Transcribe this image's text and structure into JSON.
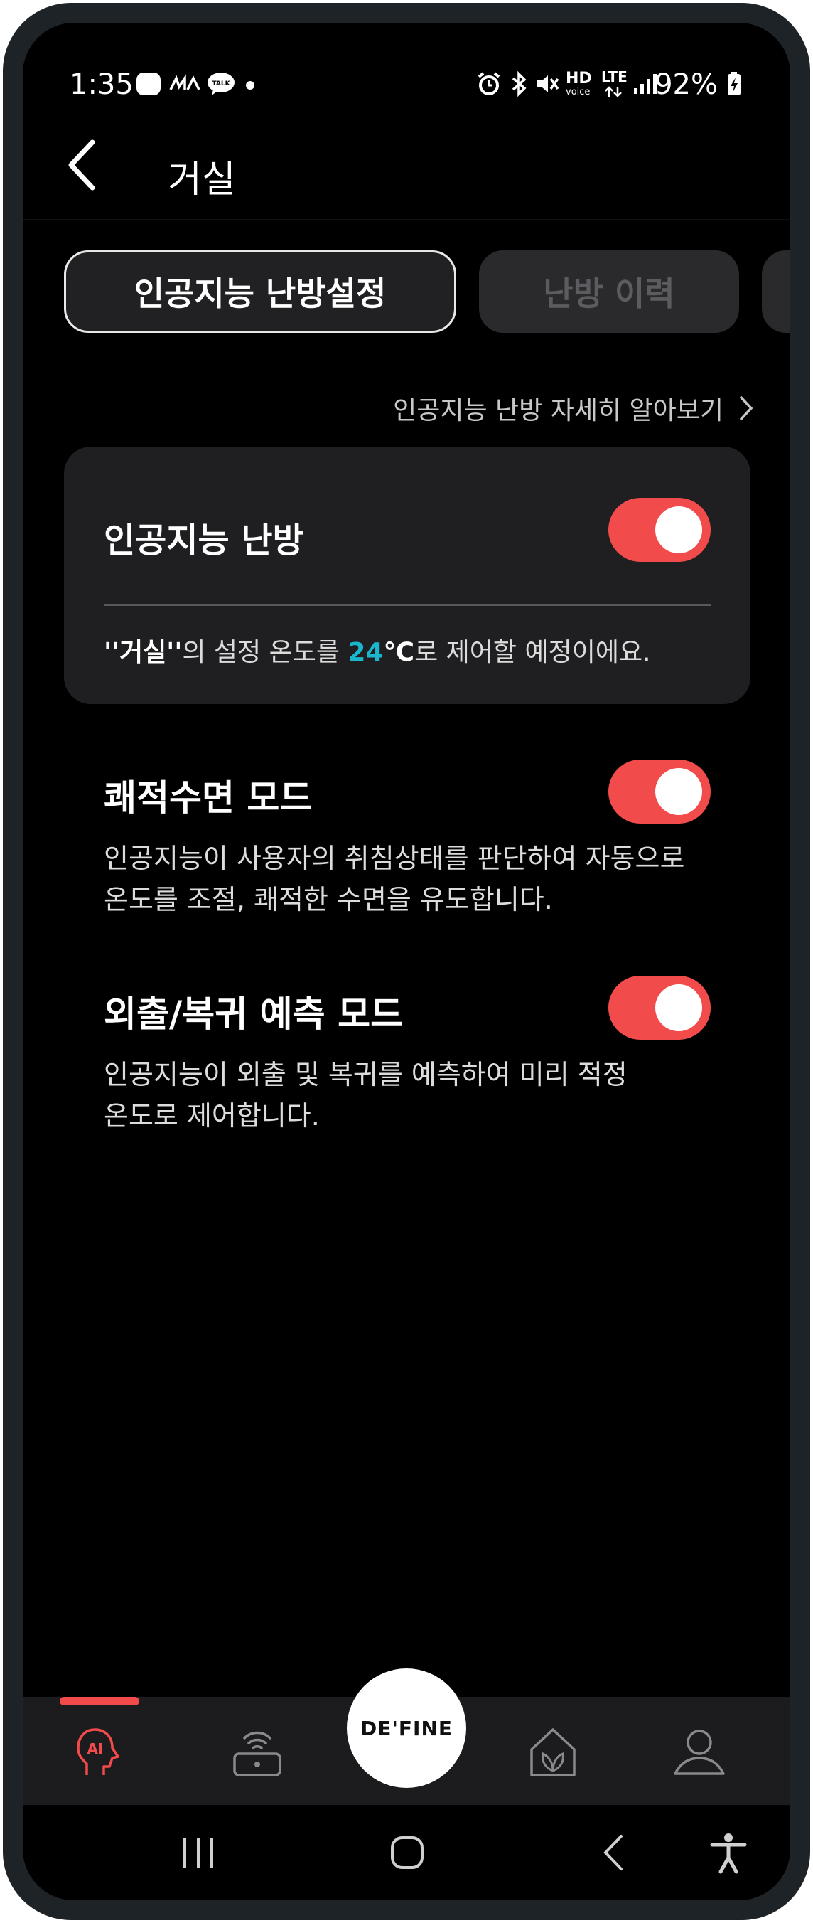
{
  "status_bar": {
    "time": "1:35",
    "battery_percent": "92%",
    "talk_badge": "TALK",
    "hd_label": "HD",
    "voice_label": "voice",
    "lte_label": "LTE"
  },
  "header": {
    "title": "거실"
  },
  "tabs": [
    {
      "label": "인공지능 난방설정",
      "active": true
    },
    {
      "label": "난방 이력",
      "active": false
    }
  ],
  "learn_more": {
    "label": "인공지능 난방 자세히 알아보기"
  },
  "ai_heating": {
    "title": "인공지능 난방",
    "enabled": true,
    "desc_quote_open": "''",
    "room": "거실",
    "desc_quote_close": "''",
    "desc_mid": "의 설정 온도를 ",
    "temperature": "24",
    "unit": "℃",
    "desc_tail": "로 제어할 예정이에요."
  },
  "sleep_mode": {
    "title": "쾌적수면 모드",
    "enabled": true,
    "desc_line1": "인공지능이 사용자의 취침상태를 판단하여 자동으로",
    "desc_line2": "온도를 조절, 쾌적한 수면을 유도합니다."
  },
  "away_mode": {
    "title": "외출/복귀 예측 모드",
    "enabled": true,
    "desc_line1": "인공지능이 외출 및 복귀를 예측하여 미리 적정",
    "desc_line2": "온도로 제어합니다."
  },
  "bottom_nav": {
    "ai_label": "AI",
    "center_logo": "DE'FINE",
    "active_color": "#f24b4b",
    "inactive_color": "#8a8a8e"
  },
  "colors": {
    "accent": "#f24b4b",
    "temperature": "#1bb6cc"
  }
}
